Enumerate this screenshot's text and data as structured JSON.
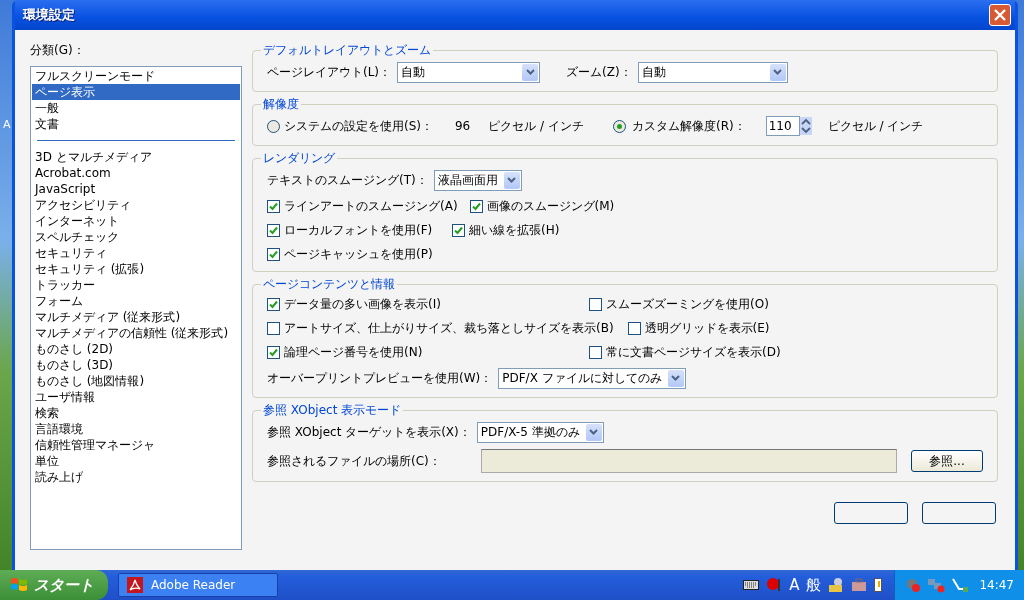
{
  "window": {
    "title": "環境設定"
  },
  "desktop": {
    "icon_label": "A"
  },
  "categories": {
    "label": "分類(G)：",
    "primary_items": [
      {
        "label": "フルスクリーンモード",
        "selected": false
      },
      {
        "label": "ページ表示",
        "selected": true
      },
      {
        "label": "一般",
        "selected": false
      },
      {
        "label": "文書",
        "selected": false
      }
    ],
    "items": [
      {
        "label": "3D とマルチメディア",
        "selected": false
      },
      {
        "label": "Acrobat.com",
        "selected": false
      },
      {
        "label": "JavaScript",
        "selected": false
      },
      {
        "label": "アクセシビリティ",
        "selected": false
      },
      {
        "label": "インターネット",
        "selected": false
      },
      {
        "label": "スペルチェック",
        "selected": false
      },
      {
        "label": "セキュリティ",
        "selected": false
      },
      {
        "label": "セキュリティ (拡張)",
        "selected": false
      },
      {
        "label": "トラッカー",
        "selected": false
      },
      {
        "label": "フォーム",
        "selected": false
      },
      {
        "label": "マルチメディア (従来形式)",
        "selected": false
      },
      {
        "label": "マルチメディアの信頼性 (従来形式)",
        "selected": false
      },
      {
        "label": "ものさし (2D)",
        "selected": false
      },
      {
        "label": "ものさし (3D)",
        "selected": false
      },
      {
        "label": "ものさし (地図情報)",
        "selected": false
      },
      {
        "label": "ユーザ情報",
        "selected": false
      },
      {
        "label": "検索",
        "selected": false
      },
      {
        "label": "言語環境",
        "selected": false
      },
      {
        "label": "信頼性管理マネージャ",
        "selected": false
      },
      {
        "label": "単位",
        "selected": false
      },
      {
        "label": "読み上げ",
        "selected": false
      }
    ]
  },
  "layout_zoom": {
    "title": "デフォルトレイアウトとズーム",
    "page_layout": {
      "label": "ページレイアウト(L)：",
      "value": "自動"
    },
    "zoom": {
      "label": "ズーム(Z)：",
      "value": "自動"
    }
  },
  "resolution": {
    "title": "解像度",
    "options": [
      {
        "kind": "fixed",
        "label": "システムの設定を使用(S)：",
        "selected": false,
        "value": "96",
        "unit": "ピクセル / インチ"
      },
      {
        "kind": "spin",
        "label": "カスタム解像度(R)：",
        "selected": true,
        "value": "110",
        "unit": "ピクセル / インチ"
      }
    ]
  },
  "rendering": {
    "title": "レンダリング",
    "text_smoothing": {
      "label": "テキストのスムージング(T)：",
      "value": "液晶画面用"
    },
    "checkbox_rows": [
      [
        {
          "label": "ラインアートのスムージング(A)",
          "checked": true
        },
        {
          "label": "画像のスムージング(M)",
          "checked": true
        }
      ],
      [
        {
          "label": "ローカルフォントを使用(F)",
          "checked": true
        },
        {
          "label": "細い線を拡張(H)",
          "checked": true
        }
      ],
      [
        {
          "label": "ページキャッシュを使用(P)",
          "checked": true
        }
      ]
    ]
  },
  "page_content": {
    "title": "ページコンテンツと情報",
    "checkbox_rows": [
      [
        {
          "label": "データ量の多い画像を表示(I)",
          "checked": true
        },
        {
          "label": "スムーズズーミングを使用(O)",
          "checked": false
        }
      ],
      [
        {
          "label": "アートサイズ、仕上がりサイズ、裁ち落としサイズを表示(B)",
          "checked": false
        },
        {
          "label": "透明グリッドを表示(E)",
          "checked": false
        }
      ],
      [
        {
          "label": "論理ページ番号を使用(N)",
          "checked": true
        },
        {
          "label": "常に文書ページサイズを表示(D)",
          "checked": false
        }
      ]
    ],
    "overprint": {
      "label": "オーバープリントプレビューを使用(W)：",
      "value": "PDF/X ファイルに対してのみ"
    }
  },
  "xobject": {
    "title": "参照 XObject 表示モード",
    "target": {
      "label": "参照 XObject ターゲットを表示(X)：",
      "value": "PDF/X-5 準拠のみ"
    },
    "location": {
      "label": "参照されるファイルの場所(C)：",
      "disabled": true
    },
    "browse_button": "参照..."
  },
  "taskbar": {
    "start": "スタート",
    "tasks": [
      {
        "label": "Adobe Reader",
        "selected": false
      }
    ],
    "language_bar": [
      "A",
      "般"
    ],
    "clock": "14:47"
  }
}
